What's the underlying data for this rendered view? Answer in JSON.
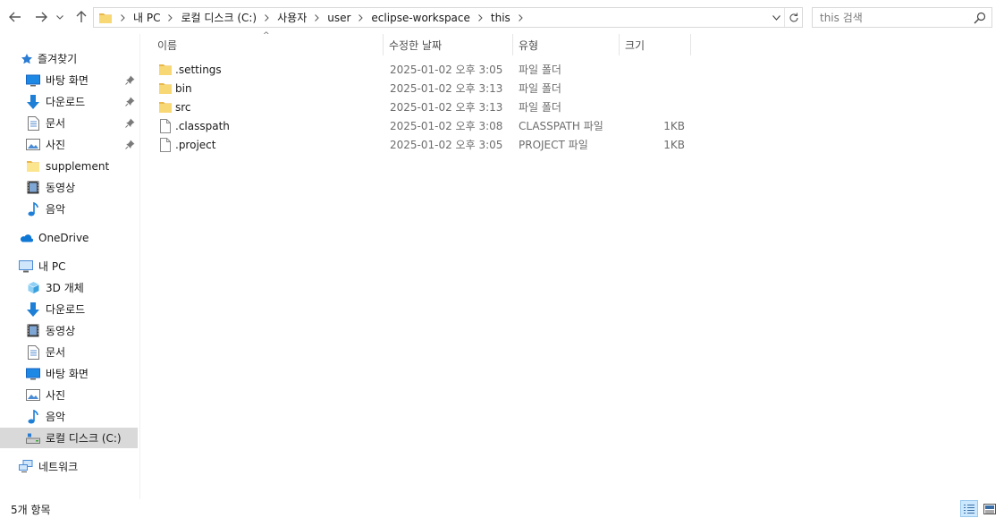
{
  "address": {
    "crumbs": [
      "내 PC",
      "로컬 디스크 (C:)",
      "사용자",
      "user",
      "eclipse-workspace",
      "this"
    ]
  },
  "search": {
    "placeholder": "this 검색"
  },
  "sidebar": {
    "quick_access": {
      "label": "즐겨찾기",
      "items": [
        {
          "label": "바탕 화면",
          "icon": "desktop-icon",
          "pinned": true
        },
        {
          "label": "다운로드",
          "icon": "download-icon",
          "pinned": true
        },
        {
          "label": "문서",
          "icon": "document-icon",
          "pinned": true
        },
        {
          "label": "사진",
          "icon": "pictures-icon",
          "pinned": true
        },
        {
          "label": "supplement",
          "icon": "folder-icon",
          "pinned": false
        },
        {
          "label": "동영상",
          "icon": "video-icon",
          "pinned": false
        },
        {
          "label": "음악",
          "icon": "music-icon",
          "pinned": false
        }
      ]
    },
    "onedrive": {
      "label": "OneDrive"
    },
    "this_pc": {
      "label": "내 PC",
      "items": [
        {
          "label": "3D 개체",
          "icon": "3d-objects-icon"
        },
        {
          "label": "다운로드",
          "icon": "download-icon"
        },
        {
          "label": "동영상",
          "icon": "video-icon"
        },
        {
          "label": "문서",
          "icon": "document-icon"
        },
        {
          "label": "바탕 화면",
          "icon": "desktop-icon"
        },
        {
          "label": "사진",
          "icon": "pictures-icon"
        },
        {
          "label": "음악",
          "icon": "music-icon"
        },
        {
          "label": "로컬 디스크 (C:)",
          "icon": "drive-icon",
          "selected": true
        }
      ]
    },
    "network": {
      "label": "네트워크"
    }
  },
  "columns": {
    "name": "이름",
    "date": "수정한 날짜",
    "type": "유형",
    "size": "크기"
  },
  "files": [
    {
      "name": ".settings",
      "date": "2025-01-02 오후 3:05",
      "type": "파일 폴더",
      "size": "",
      "kind": "folder"
    },
    {
      "name": "bin",
      "date": "2025-01-02 오후 3:13",
      "type": "파일 폴더",
      "size": "",
      "kind": "folder"
    },
    {
      "name": "src",
      "date": "2025-01-02 오후 3:13",
      "type": "파일 폴더",
      "size": "",
      "kind": "folder"
    },
    {
      "name": ".classpath",
      "date": "2025-01-02 오후 3:08",
      "type": "CLASSPATH 파일",
      "size": "1KB",
      "kind": "file"
    },
    {
      "name": ".project",
      "date": "2025-01-02 오후 3:05",
      "type": "PROJECT 파일",
      "size": "1KB",
      "kind": "file"
    }
  ],
  "status": {
    "item_count": "5개 항목"
  },
  "colors": {
    "folder": "#f8d775",
    "selection": "#cce8ff",
    "accent": "#0078d7"
  }
}
